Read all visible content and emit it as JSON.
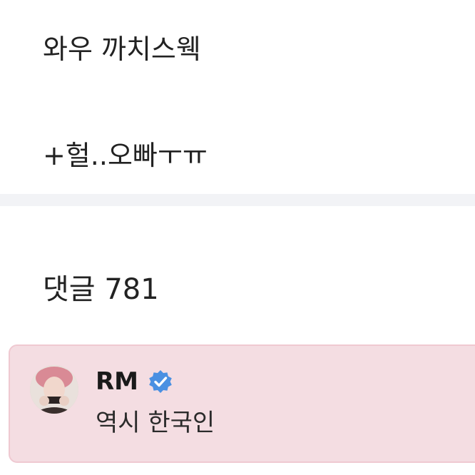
{
  "post": {
    "line1": "와우 까치스웩",
    "line2": "+헐..오빠ㅜㅠ"
  },
  "comments": {
    "header": "댓글 781",
    "items": [
      {
        "author": "RM",
        "verified": true,
        "text": "역시 한국인",
        "highlight_color": "#f4dde2"
      }
    ]
  },
  "colors": {
    "verified_badge": "#4a90e2",
    "divider": "#f2f3f6"
  }
}
